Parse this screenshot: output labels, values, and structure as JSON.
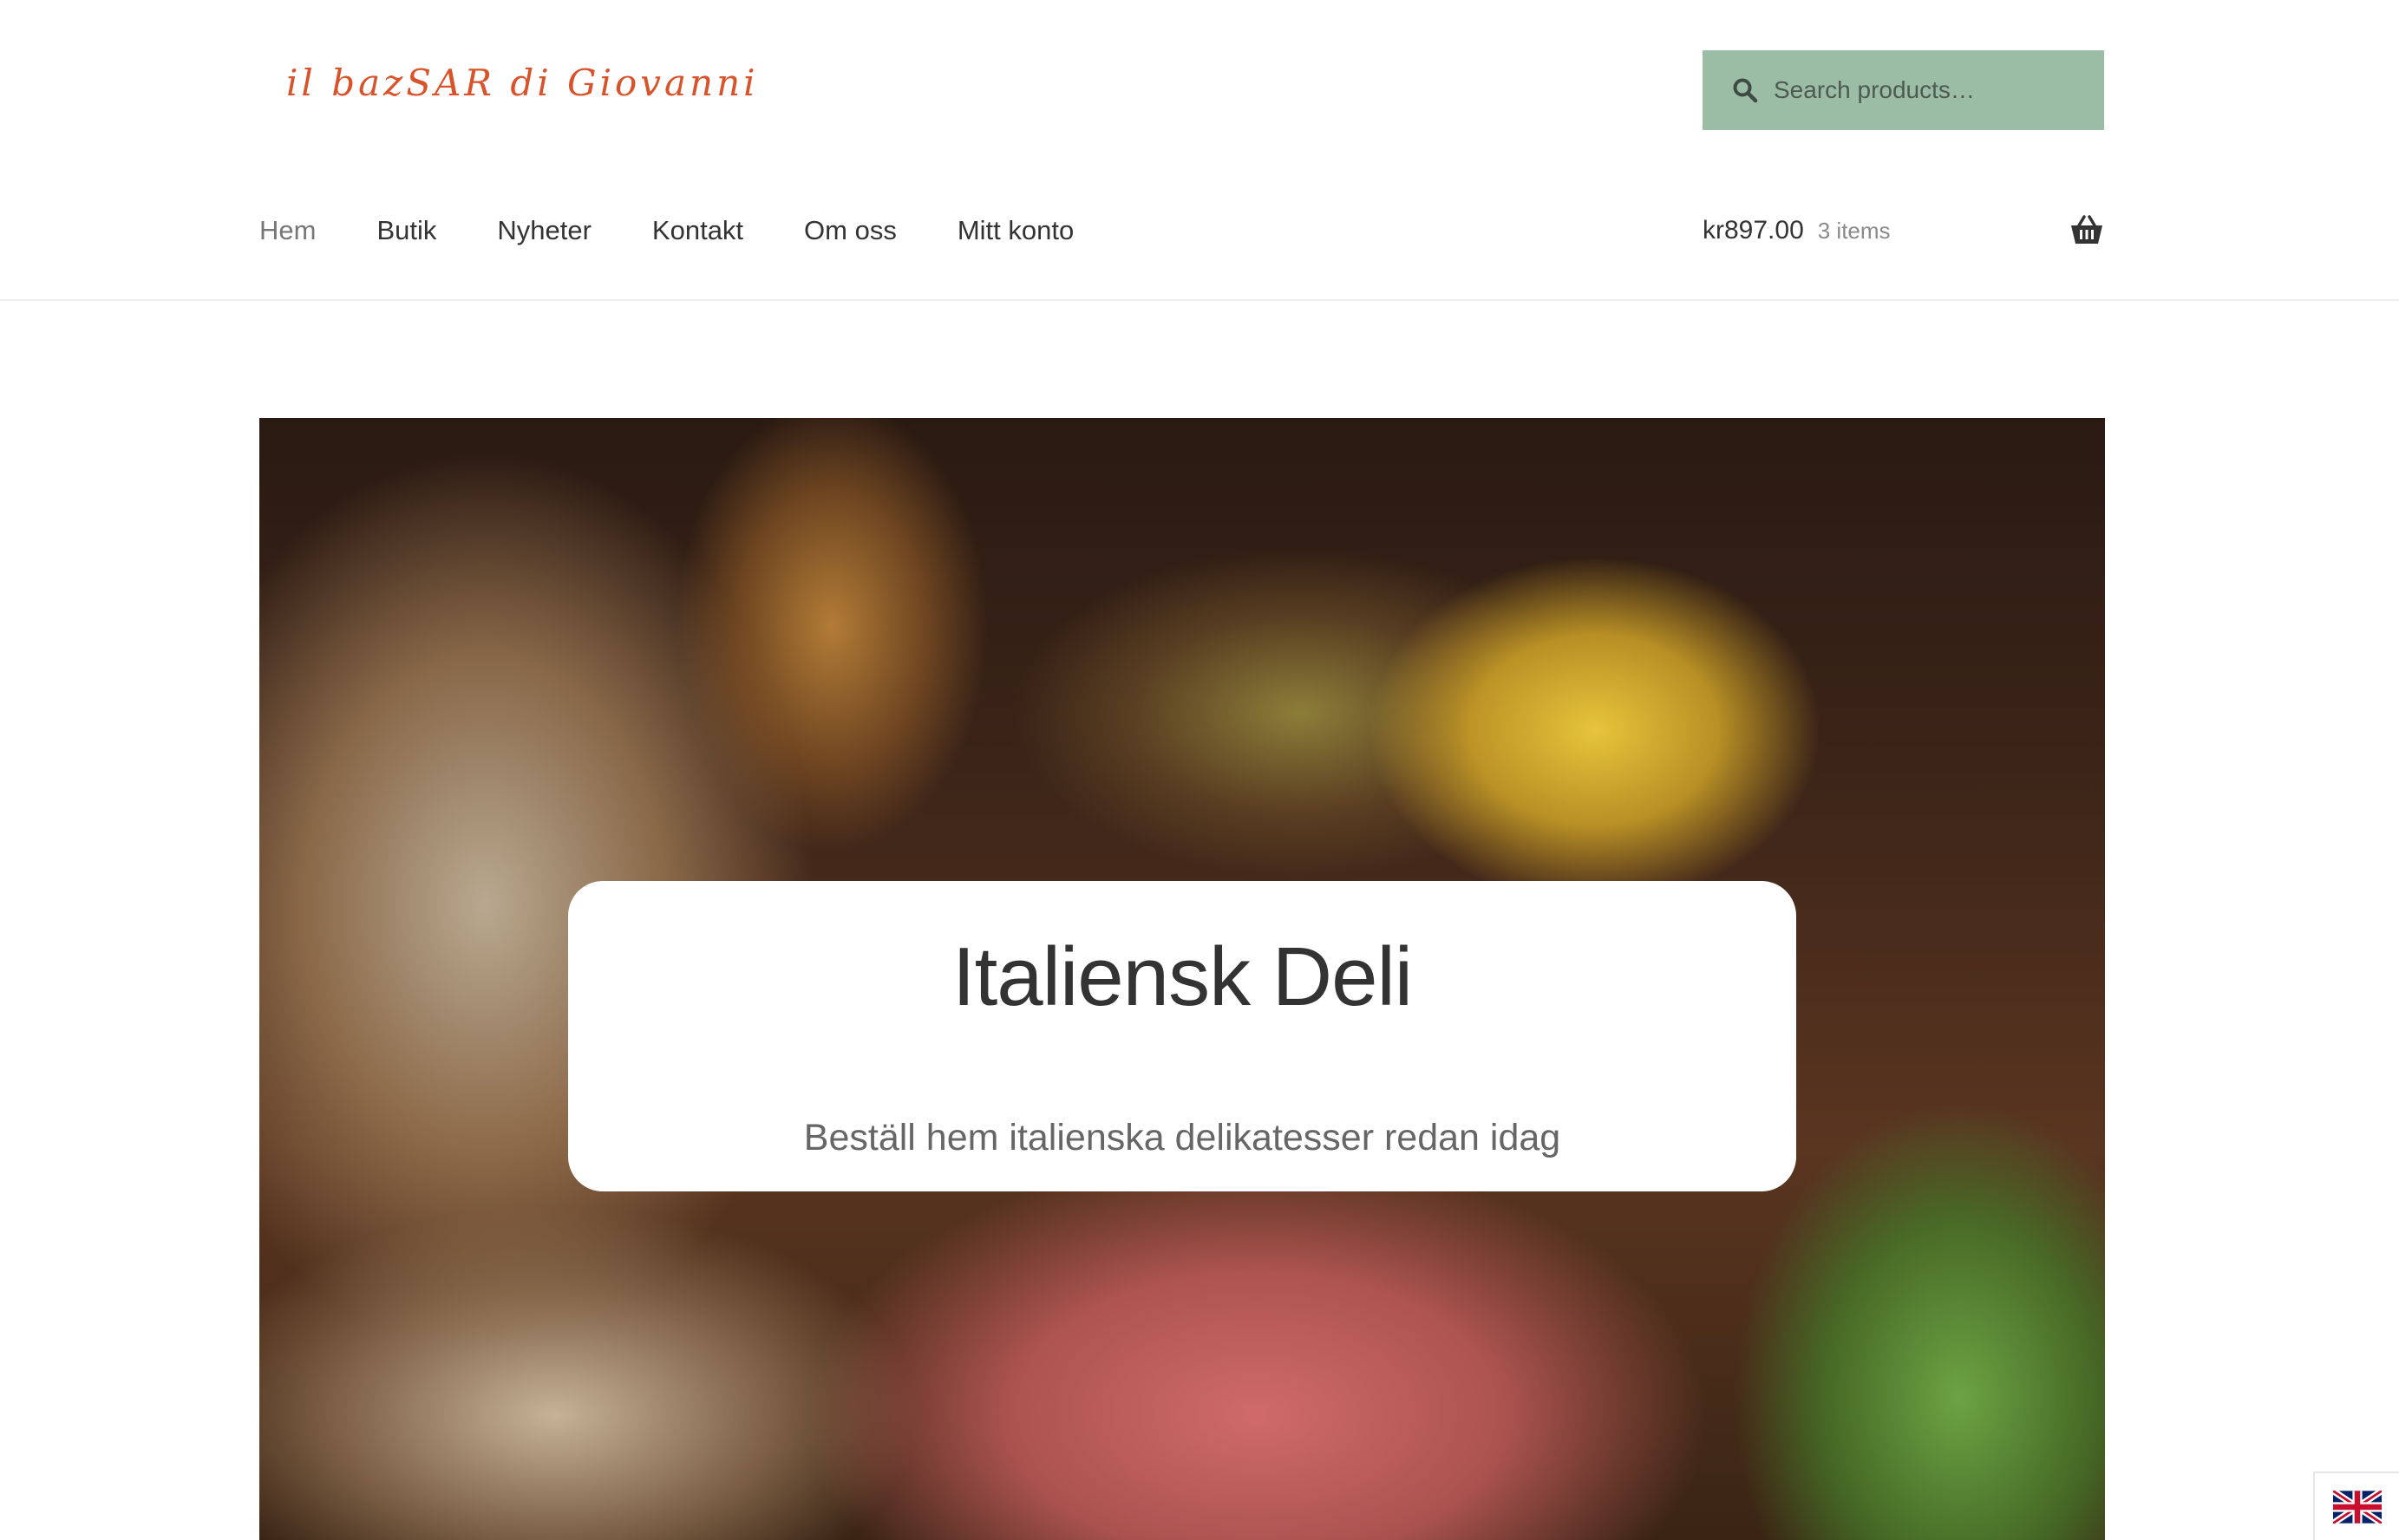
{
  "site": {
    "logo_text": "il bazSAR di Giovanni"
  },
  "search": {
    "placeholder": "Search products…",
    "icon": "search-icon"
  },
  "nav": {
    "items": [
      {
        "label": "Hem",
        "active": true
      },
      {
        "label": "Butik"
      },
      {
        "label": "Nyheter"
      },
      {
        "label": "Kontakt"
      },
      {
        "label": "Om oss"
      },
      {
        "label": "Mitt konto"
      }
    ]
  },
  "cart": {
    "amount": "kr897.00",
    "count": "3 items",
    "icon": "basket-icon"
  },
  "hero": {
    "title": "Italiensk Deli",
    "subtitle": "Beställ hem italienska delikatesser redan idag"
  },
  "language": {
    "icon": "uk-flag-icon"
  },
  "colors": {
    "logo": "#d9532a",
    "search_bg": "#9cbda5",
    "text": "#333333",
    "active_nav": "#777777"
  }
}
